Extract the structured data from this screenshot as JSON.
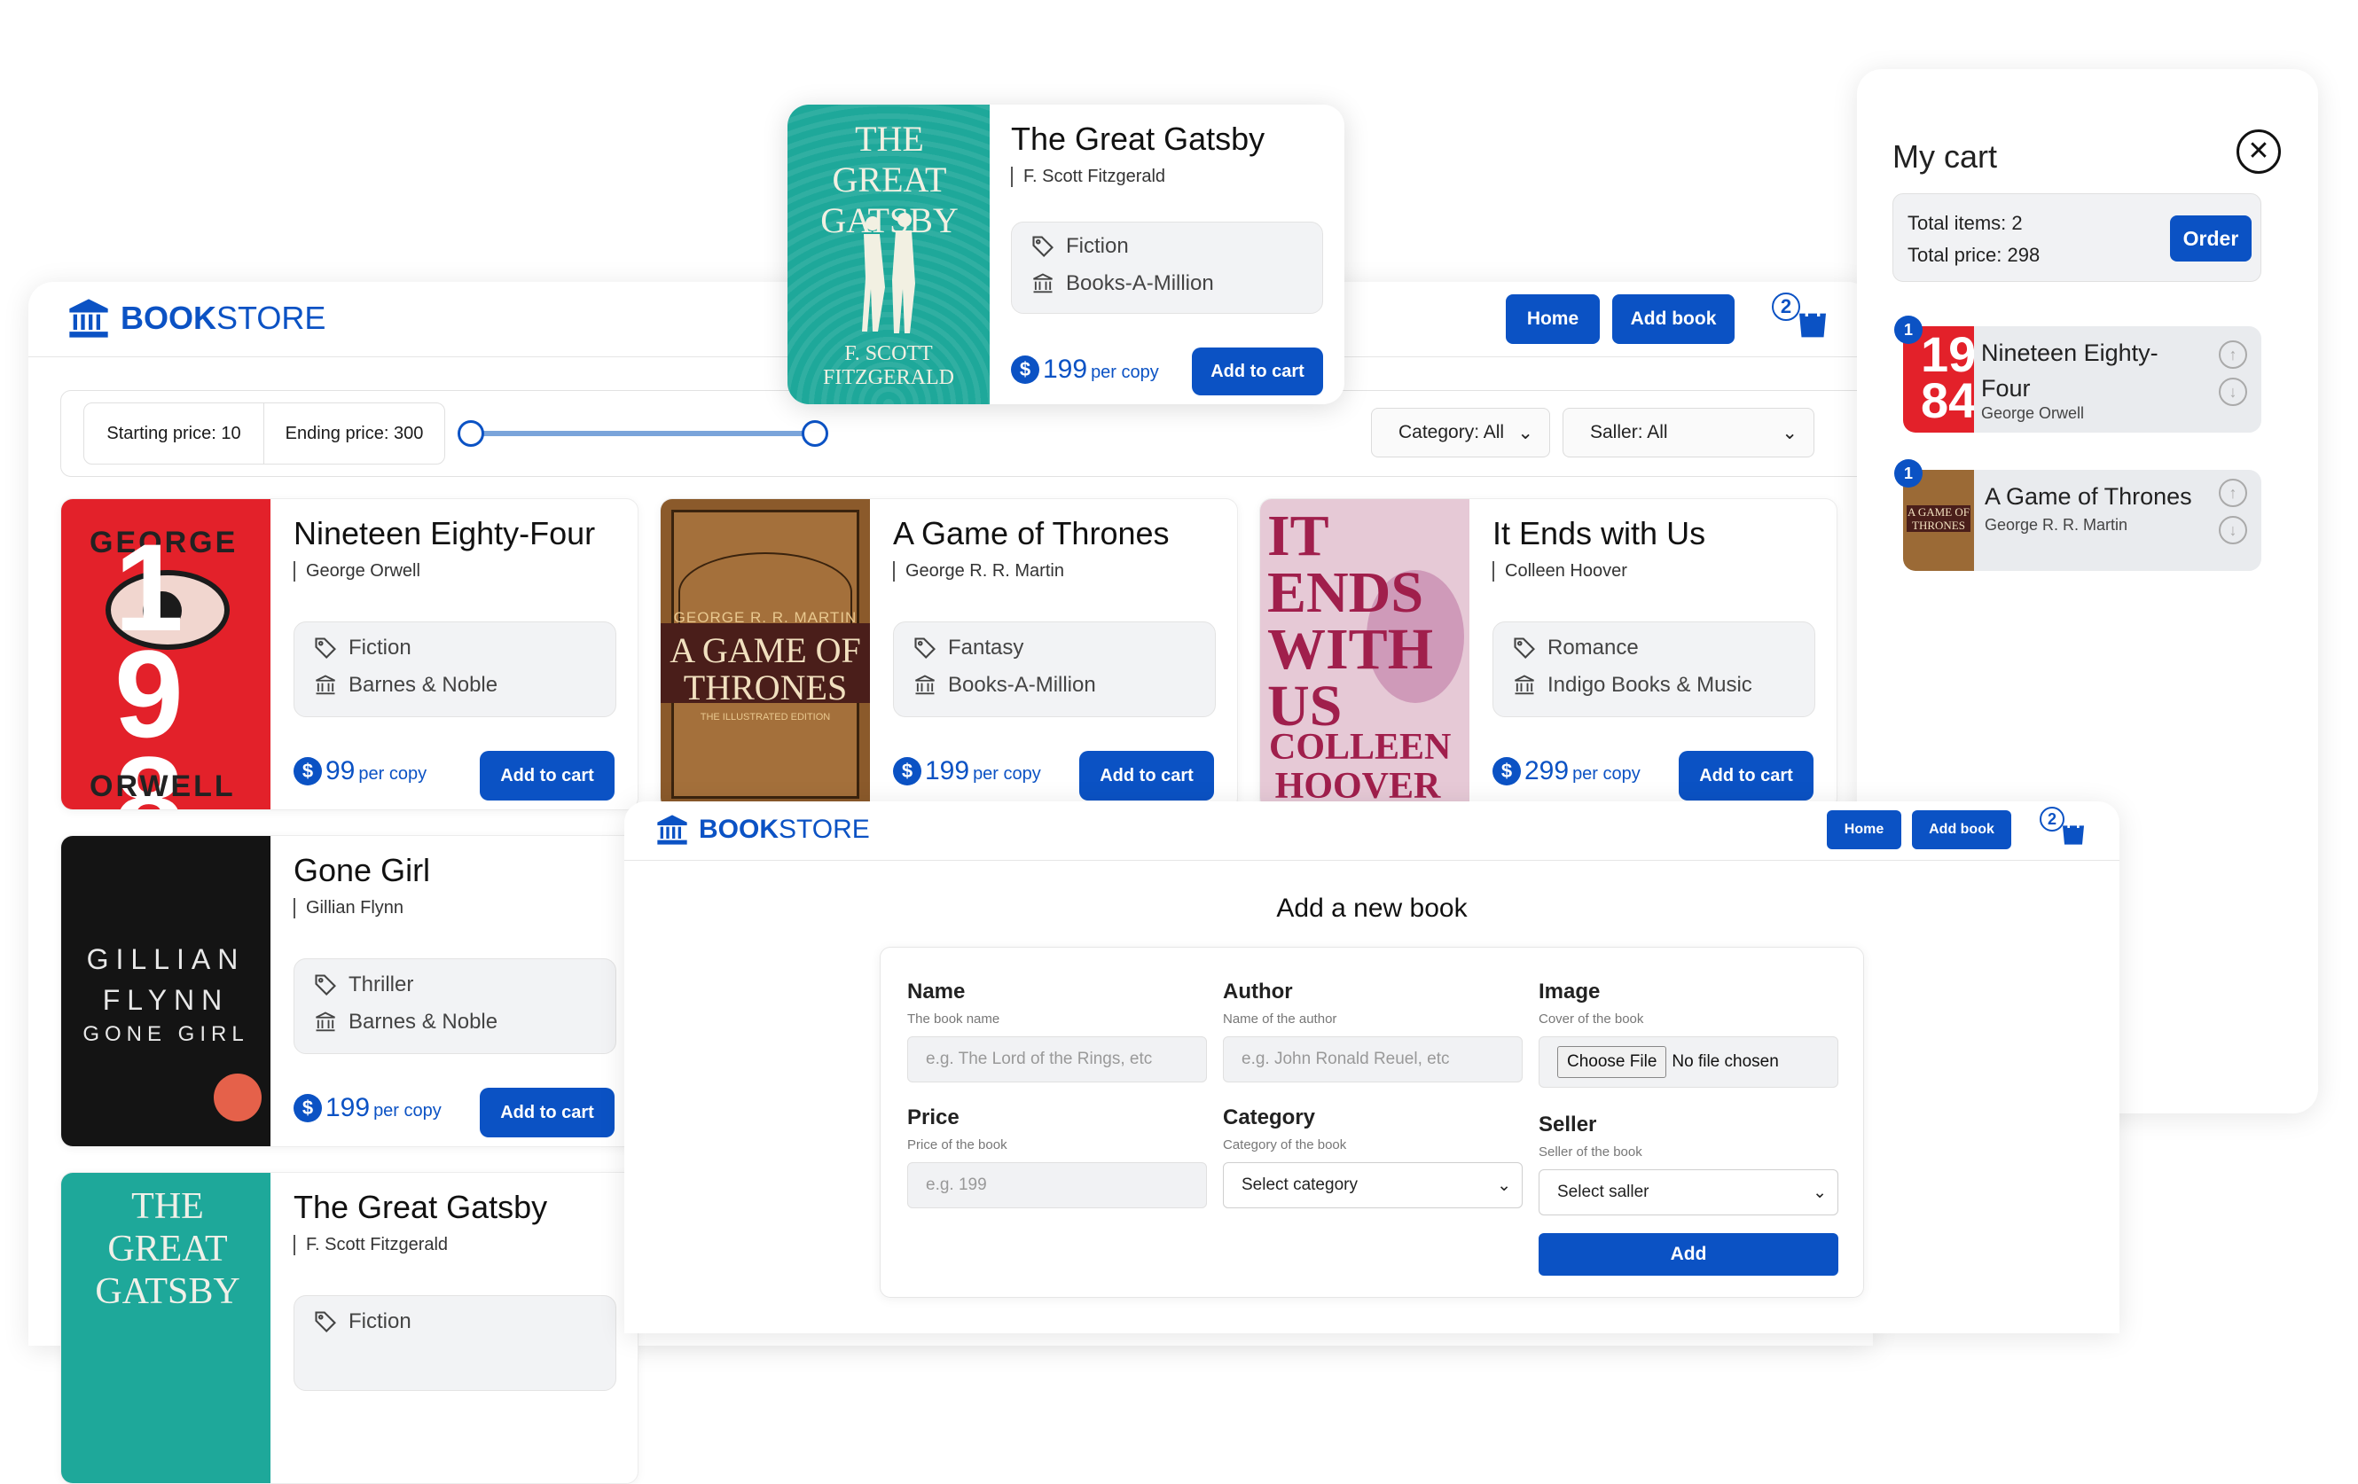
{
  "brand": {
    "bold": "BOOK",
    "regular": "STORE"
  },
  "nav": {
    "home": "Home",
    "add_book": "Add book",
    "cart_count": "2"
  },
  "filter": {
    "starting_price": "Starting price: 10",
    "ending_price": "Ending price: 300",
    "category": "Category: All",
    "seller": "Saller: All"
  },
  "books": [
    {
      "title": "Nineteen Eighty-Four",
      "author": "George Orwell",
      "category": "Fiction",
      "store": "Barnes & Noble",
      "price": "99",
      "per": "per copy",
      "button": "Add to cart",
      "cover_text_top": "GEORGE",
      "cover_text_bottom": "ORWELL",
      "cover_big": "19 84"
    },
    {
      "title": "A Game of Thrones",
      "author": "George R. R. Martin",
      "category": "Fantasy",
      "store": "Books-A-Million",
      "price": "199",
      "per": "per copy",
      "button": "Add to cart",
      "cover_text_top": "GEORGE R. R. MARTIN",
      "cover_big": "A GAME OF THRONES",
      "cover_sub": "THE ILLUSTRATED EDITION"
    },
    {
      "title": "It Ends with Us",
      "author": "Colleen Hoover",
      "category": "Romance",
      "store": "Indigo Books & Music",
      "price": "299",
      "per": "per copy",
      "button": "Add to cart",
      "cover_big": "IT ENDS WITH US",
      "cover_text_bottom": "COLLEEN HOOVER"
    },
    {
      "title": "Gone Girl",
      "author": "Gillian Flynn",
      "category": "Thriller",
      "store": "Barnes & Noble",
      "price": "199",
      "per": "per copy",
      "button": "Add to cart",
      "cover_big": "GILLIAN FLYNN",
      "cover_sub": "GONE GIRL"
    },
    {
      "title": "The Great Gatsby",
      "author": "F. Scott Fitzgerald",
      "category": "Fiction"
    }
  ],
  "popup": {
    "title": "The Great Gatsby",
    "author": "F. Scott Fitzgerald",
    "category": "Fiction",
    "store": "Books-A-Million",
    "price": "199",
    "per": "per copy",
    "button": "Add to cart",
    "cover_big": "THE GREAT GATSBY",
    "cover_author": "F. SCOTT FITZGERALD"
  },
  "cart": {
    "title": "My cart",
    "total_items": "Total items: 2",
    "total_price": "Total price: 298",
    "order": "Order",
    "items": [
      {
        "qty": "1",
        "title": "Nineteen Eighty-Four",
        "author": "George Orwell"
      },
      {
        "qty": "1",
        "title": "A Game of Thrones",
        "author": "George R. R. Martin"
      }
    ]
  },
  "form": {
    "heading": "Add a new book",
    "name": {
      "label": "Name",
      "hint": "The book name",
      "placeholder": "e.g. The Lord of the Rings, etc"
    },
    "author": {
      "label": "Author",
      "hint": "Name of the author",
      "placeholder": "e.g. John Ronald Reuel, etc"
    },
    "image": {
      "label": "Image",
      "hint": "Cover of the book",
      "button": "Choose File",
      "status": "No file chosen"
    },
    "price": {
      "label": "Price",
      "hint": "Price of the book",
      "placeholder": "e.g. 199"
    },
    "category": {
      "label": "Category",
      "hint": "Category of the book",
      "select": "Select category"
    },
    "seller": {
      "label": "Seller",
      "hint": "Seller of the book",
      "select": "Select saller"
    },
    "submit": "Add"
  },
  "colors": {
    "primary": "#0b52c4",
    "card_meta_bg": "#f2f3f5"
  }
}
